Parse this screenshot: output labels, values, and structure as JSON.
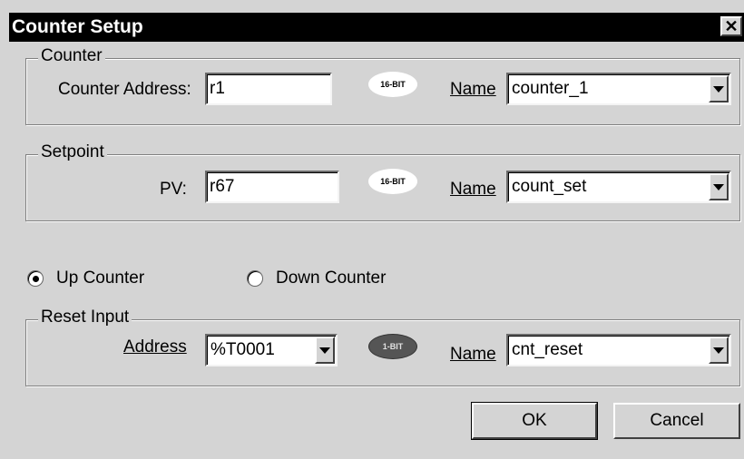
{
  "window": {
    "title": "Counter Setup",
    "close_glyph": "✕"
  },
  "counter_group": {
    "title": "Counter",
    "address_label": "Counter Address:",
    "address_value": "r1",
    "bit_badge": "16-BIT",
    "name_label": "Name",
    "name_value": "counter_1"
  },
  "setpoint_group": {
    "title": "Setpoint",
    "pv_label": "PV:",
    "pv_value": "r67",
    "bit_badge": "16-BIT",
    "name_label": "Name",
    "name_value": "count_set"
  },
  "mode": {
    "up_label": "Up Counter",
    "down_label": "Down Counter",
    "selected": "up"
  },
  "reset_group": {
    "title": "Reset Input",
    "address_label": "Address",
    "address_value": "%T0001",
    "bit_badge": "1-BIT",
    "name_label": "Name",
    "name_value": "cnt_reset"
  },
  "buttons": {
    "ok": "OK",
    "cancel": "Cancel"
  }
}
